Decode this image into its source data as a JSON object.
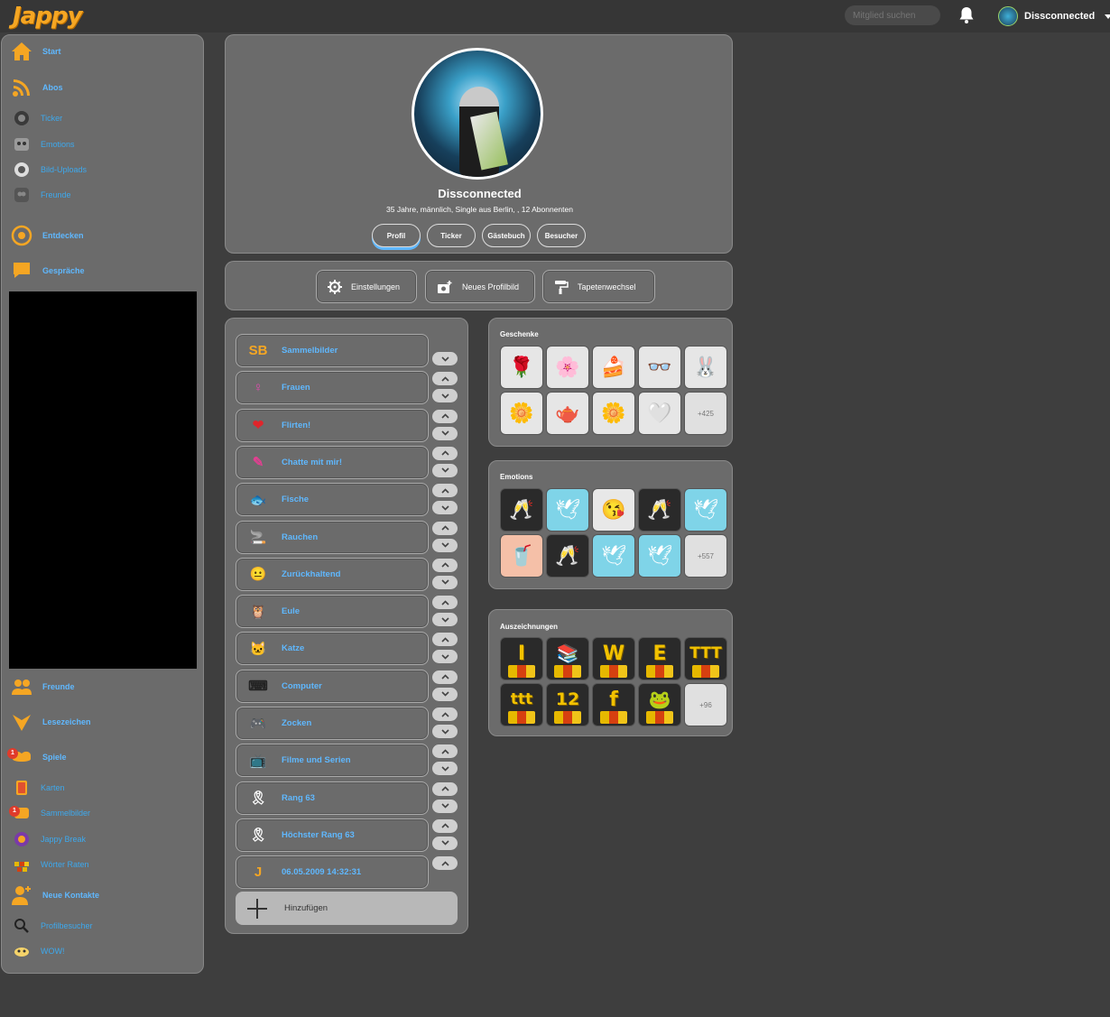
{
  "header": {
    "logo": "Jappy",
    "search_placeholder": "Mitglied suchen",
    "username": "Dissconnected"
  },
  "sidebar": {
    "items": [
      {
        "label": "Start",
        "icon": "home-icon",
        "main": true
      },
      {
        "label": "Abos",
        "icon": "rss-icon",
        "main": true
      },
      {
        "label": "Ticker",
        "icon": "ticker-icon",
        "main": false
      },
      {
        "label": "Emotions",
        "icon": "emotions-icon",
        "main": false
      },
      {
        "label": "Bild-Uploads",
        "icon": "image-upload-icon",
        "main": false
      },
      {
        "label": "Freunde",
        "icon": "friends-icon",
        "main": false
      },
      {
        "label": "Entdecken",
        "icon": "compass-icon",
        "main": true
      },
      {
        "label": "Gespräche",
        "icon": "chat-icon",
        "main": true
      }
    ],
    "items_bottom": [
      {
        "label": "Freunde",
        "icon": "friends-icon",
        "main": true
      },
      {
        "label": "Lesezeichen",
        "icon": "bookmark-icon",
        "main": true
      },
      {
        "label": "Spiele",
        "icon": "games-icon",
        "main": true,
        "badge": "1"
      },
      {
        "label": "Karten",
        "icon": "cards-icon",
        "main": false
      },
      {
        "label": "Sammelbilder",
        "icon": "collect-icon",
        "main": false,
        "badge": "1"
      },
      {
        "label": "Jappy Break",
        "icon": "jappy-break-icon",
        "main": false
      },
      {
        "label": "Wörter Raten",
        "icon": "word-guess-icon",
        "main": false
      },
      {
        "label": "Neue Kontakte",
        "icon": "new-contacts-icon",
        "main": true
      },
      {
        "label": "Profilbesucher",
        "icon": "visitors-icon",
        "main": false
      },
      {
        "label": "WOW!",
        "icon": "wow-icon",
        "main": false
      }
    ]
  },
  "profile": {
    "name": "Dissconnected",
    "info": "35 Jahre, männlich, Single aus Berlin, , 12 Abonnenten",
    "tabs": [
      "Profil",
      "Ticker",
      "Gästebuch",
      "Besucher"
    ],
    "active_tab": "Profil"
  },
  "actions": [
    "Einstellungen",
    "Neues Profilbild",
    "Tapetenwechsel"
  ],
  "interests": [
    {
      "label": "Sammelbilder",
      "icon": "sb-icon",
      "color": "#f5a623"
    },
    {
      "label": "Frauen",
      "icon": "female-icon",
      "color": "#e24bb0"
    },
    {
      "label": "Flirten!",
      "icon": "hearts-icon",
      "color": "#e0252b"
    },
    {
      "label": "Chatte mit mir!",
      "icon": "chat-notebook-icon",
      "color": "#e23f91"
    },
    {
      "label": "Fische",
      "icon": "fish-icon",
      "color": "#2a8ee0"
    },
    {
      "label": "Rauchen",
      "icon": "cigarette-icon",
      "color": "#c07040"
    },
    {
      "label": "Zurückhaltend",
      "icon": "reserved-smiley-icon",
      "color": "#f2c200"
    },
    {
      "label": "Eule",
      "icon": "owl-icon",
      "color": "#a080e0"
    },
    {
      "label": "Katze",
      "icon": "cat-icon",
      "color": "#c8c8c8"
    },
    {
      "label": "Computer",
      "icon": "keyboard-icon",
      "color": "#222222"
    },
    {
      "label": "Zocken",
      "icon": "gamepad-icon",
      "color": "#d0d0d0"
    },
    {
      "label": "Filme und Serien",
      "icon": "tv-icon",
      "color": "#303030"
    },
    {
      "label": "Rang 63",
      "icon": "rank-ribbon-icon",
      "color": "#ffffff"
    },
    {
      "label": "Höchster Rang 63",
      "icon": "top-rank-ribbon-icon",
      "color": "#ffffff"
    },
    {
      "label": "06.05.2009 14:32:31",
      "icon": "jappy-join-icon",
      "color": "#f5a623"
    }
  ],
  "add_label": "Hinzufügen",
  "gifts": {
    "title": "Geschenke",
    "items": [
      "rose-bouquet-icon",
      "flower-branch-icon",
      "cake-icon",
      "sunglasses-icon",
      "bunny-icon",
      "tea-daisy-icon",
      "teapot-icon",
      "yellow-rose-icon",
      "white-rose-icon"
    ],
    "more": "+425"
  },
  "emotions": {
    "title": "Emotions",
    "items": [
      "champagne-icon",
      "dove-icon",
      "kiss-smiley-icon",
      "champagne-icon",
      "dove-icon",
      "cola-icon",
      "champagne-icon",
      "dove-icon",
      "dove-icon"
    ],
    "more": "+557"
  },
  "awards": {
    "title": "Auszeichnungen",
    "items": [
      {
        "icon": "award-i-icon",
        "glyph": "I"
      },
      {
        "icon": "award-books-icon",
        "glyph": ""
      },
      {
        "icon": "award-w-icon",
        "glyph": "W"
      },
      {
        "icon": "award-e-icon",
        "glyph": "E"
      },
      {
        "icon": "award-ttt-icon",
        "glyph": "TTT"
      },
      {
        "icon": "award-ttt-small-icon",
        "glyph": "ttt"
      },
      {
        "icon": "award-12-icon",
        "glyph": "12"
      },
      {
        "icon": "award-f-icon",
        "glyph": "f"
      },
      {
        "icon": "award-frog-icon",
        "glyph": ""
      }
    ],
    "more": "+96"
  },
  "colors": {
    "link": "#5fb8ff",
    "accent": "#f5a623",
    "card": "#6b6b6b",
    "page": "#3e3e3e"
  }
}
